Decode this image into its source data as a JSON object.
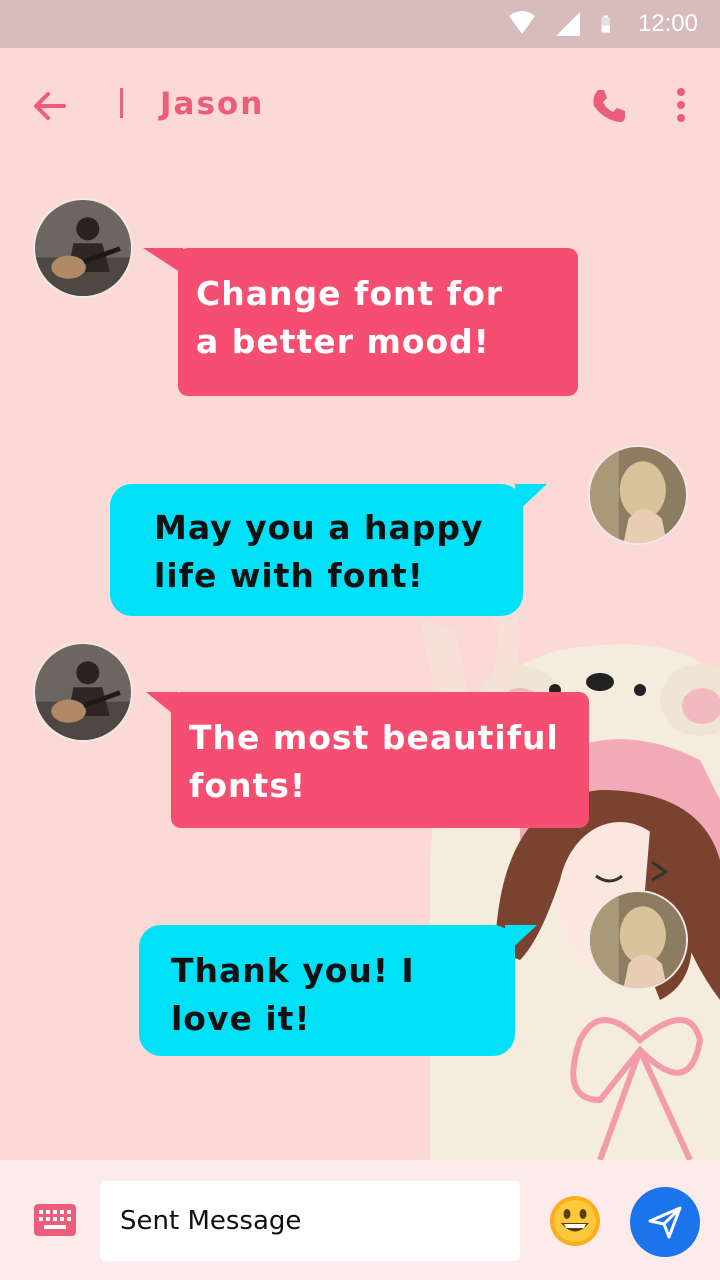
{
  "status_bar": {
    "time": "12:00",
    "icons": [
      "wifi-icon",
      "signal-icon",
      "battery-icon"
    ]
  },
  "header": {
    "contact_name": "Jason",
    "back_icon": "arrow-left-icon",
    "call_icon": "phone-icon",
    "more_icon": "more-vertical-icon"
  },
  "messages": [
    {
      "direction": "incoming",
      "text_line1": "Change font for",
      "text_line2": "a better mood!"
    },
    {
      "direction": "outgoing",
      "text_line1": "May you a happy",
      "text_line2": "life with font!"
    },
    {
      "direction": "incoming",
      "text_line1": "The most beautiful",
      "text_line2": "fonts!"
    },
    {
      "direction": "outgoing",
      "text_line1": "Thank you! I",
      "text_line2": "love it!"
    }
  ],
  "composer": {
    "placeholder": "Sent Message",
    "keyboard_icon": "keyboard-icon",
    "emoji_icon": "smiley-emoji-icon",
    "send_icon": "send-icon"
  },
  "colors": {
    "accent": "#ee5c7b",
    "incoming_bubble": "#f64e71",
    "outgoing_bubble": "#00e1f8",
    "background": "#fbd9d6",
    "send_button": "#1b74ec"
  }
}
